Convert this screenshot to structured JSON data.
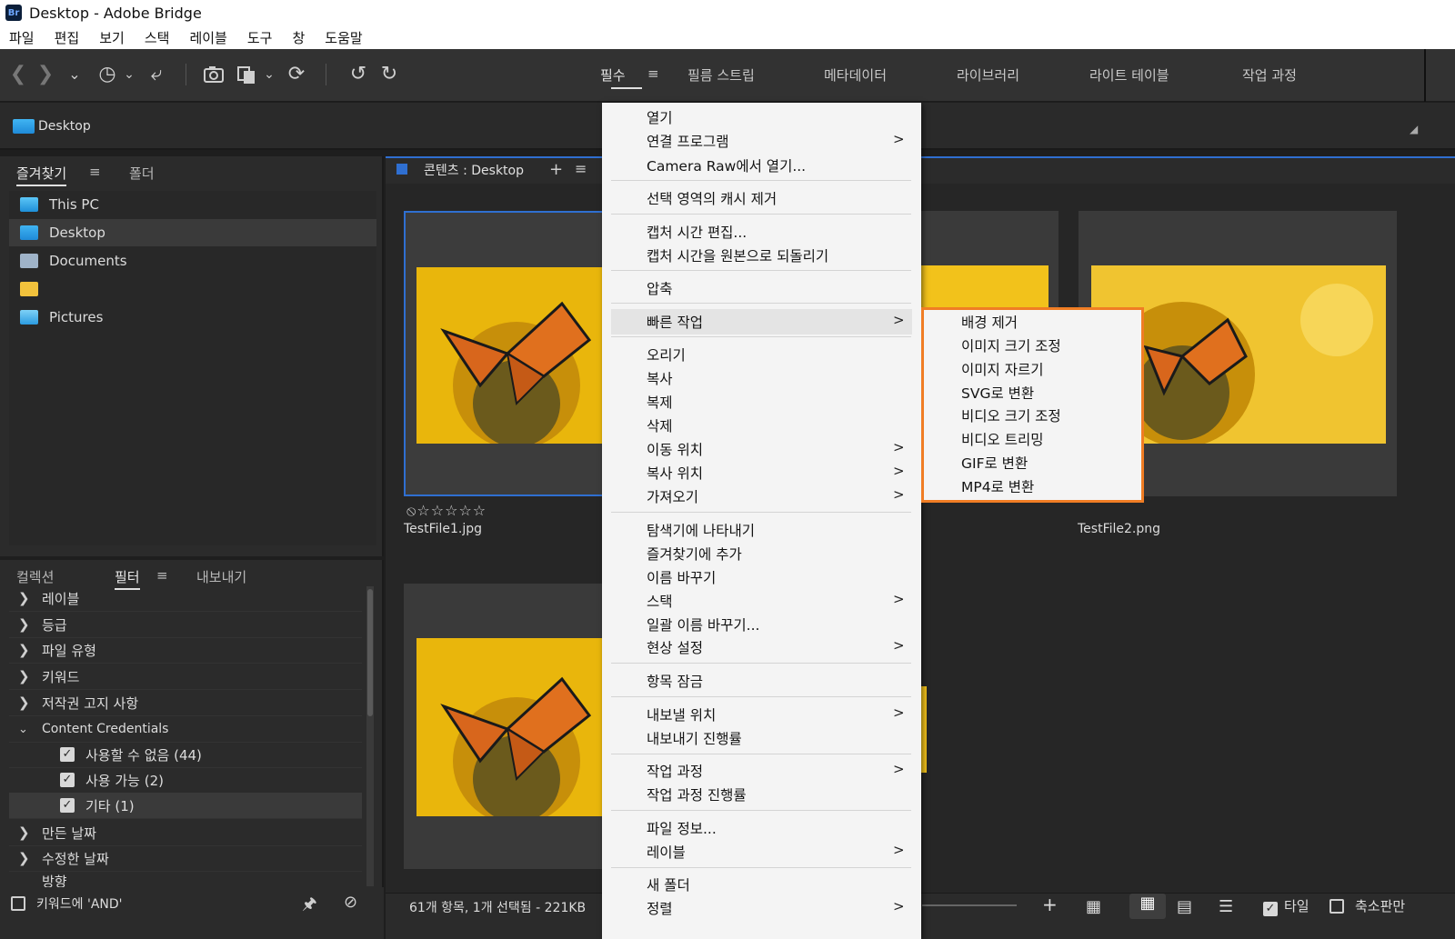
{
  "window": {
    "title": "Desktop - Adobe Bridge",
    "logo_text": "Br"
  },
  "menubar": [
    "파일",
    "편집",
    "보기",
    "스택",
    "레이블",
    "도구",
    "창",
    "도움말"
  ],
  "workspace_tabs": {
    "essentials": "필수",
    "filmstrip": "필름 스트립",
    "metadata": "메타데이터",
    "library": "라이브러리",
    "light_table": "라이트 테이블",
    "workflow": "작업 과정"
  },
  "path": {
    "current": "Desktop"
  },
  "favorites_panel": {
    "tab_favorites": "즐겨찾기",
    "tab_folders": "폴더",
    "items": [
      {
        "label": "This PC",
        "icon": "pc-icon"
      },
      {
        "label": "Desktop",
        "icon": "desktop-folder-icon"
      },
      {
        "label": "Documents",
        "icon": "documents-icon"
      },
      {
        "label": "",
        "icon": "folder-icon"
      },
      {
        "label": "Pictures",
        "icon": "pictures-icon"
      }
    ]
  },
  "filter_panel": {
    "tab_collections": "컬렉션",
    "tab_filter": "필터",
    "tab_export": "내보내기",
    "rows": [
      {
        "label": "레이블"
      },
      {
        "label": "등급"
      },
      {
        "label": "파일 유형"
      },
      {
        "label": "키워드"
      },
      {
        "label": "저작권 고지 사항"
      },
      {
        "label": "Content Credentials"
      },
      {
        "label": "사용할 수 없음 (44)"
      },
      {
        "label": "사용 가능 (2)"
      },
      {
        "label": "기타 (1)"
      },
      {
        "label": "만든 날짜"
      },
      {
        "label": "수정한 날짜"
      },
      {
        "label": "방향"
      }
    ],
    "keyword_and_label": "키워드에 'AND'"
  },
  "content_panel": {
    "title": "콘텐츠 : Desktop",
    "files": [
      {
        "name": "TestFile1.jpg",
        "rating_text": "⦸☆☆☆☆☆"
      },
      {
        "name": "TestFile2.png"
      }
    ],
    "status": "61개 항목, 1개 선택됨 - 221KB",
    "tile_label": "타일",
    "thumbnail_label": "축소판만"
  },
  "context_menu": {
    "items": [
      {
        "label": "열기"
      },
      {
        "label": "연결 프로그램",
        "sub": ">"
      },
      {
        "label": "Camera Raw에서 열기..."
      },
      {
        "label": "선택 영역의 캐시 제거"
      },
      {
        "label": "캡처 시간 편집..."
      },
      {
        "label": "캡처 시간을 원본으로 되돌리기"
      },
      {
        "label": "압축"
      },
      {
        "label": "빠른 작업",
        "sub": ">"
      },
      {
        "label": "오리기"
      },
      {
        "label": "복사"
      },
      {
        "label": "복제"
      },
      {
        "label": "삭제"
      },
      {
        "label": "이동 위치",
        "sub": ">"
      },
      {
        "label": "복사 위치",
        "sub": ">"
      },
      {
        "label": "가져오기",
        "sub": ">"
      },
      {
        "label": "탐색기에 나타내기"
      },
      {
        "label": "즐겨찾기에 추가"
      },
      {
        "label": "이름 바꾸기"
      },
      {
        "label": "스택",
        "sub": ">"
      },
      {
        "label": "일괄 이름 바꾸기..."
      },
      {
        "label": "현상 설정",
        "sub": ">"
      },
      {
        "label": "항목 잠금"
      },
      {
        "label": "내보낼 위치",
        "sub": ">"
      },
      {
        "label": "내보내기 진행률"
      },
      {
        "label": "작업 과정",
        "sub": ">"
      },
      {
        "label": "작업 과정 진행률"
      },
      {
        "label": "파일 정보..."
      },
      {
        "label": "레이블",
        "sub": ">"
      },
      {
        "label": "새 폴더"
      },
      {
        "label": "정렬",
        "sub": ">"
      }
    ]
  },
  "quick_actions_submenu": {
    "items": [
      "배경 제거",
      "이미지 크기 조정",
      "이미지 자르기",
      "SVG로 변환",
      "비디오 크기 조정",
      "비디오 트리밍",
      "GIF로 변환",
      "MP4로 변환"
    ],
    "highlight_color": "#f07d24"
  },
  "colors": {
    "accent": "#2f6fd1",
    "app_bg": "#1e1e1e"
  }
}
